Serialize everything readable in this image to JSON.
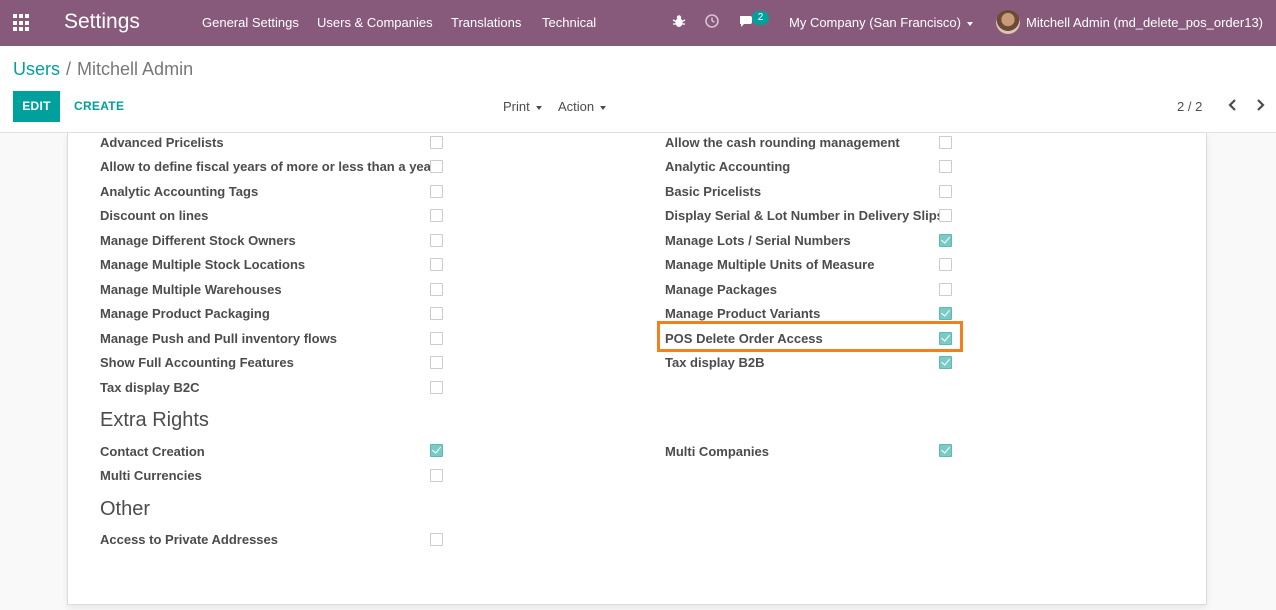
{
  "navbar": {
    "app_title": "Settings",
    "menu": [
      "General Settings",
      "Users & Companies",
      "Translations",
      "Technical"
    ],
    "message_count": "2",
    "company": "My Company (San Francisco)",
    "user": "Mitchell Admin (md_delete_pos_order13)",
    "color": "#875a7b"
  },
  "breadcrumb": {
    "parent": "Users",
    "separator": "/",
    "current": "Mitchell Admin"
  },
  "toolbar": {
    "edit": "EDIT",
    "create": "CREATE",
    "print": "Print",
    "action": "Action",
    "pager": "2 / 2"
  },
  "technical_settings": {
    "left": [
      {
        "label": "Advanced Pricelists",
        "checked": false
      },
      {
        "label": "Allow to define fiscal years of more or less than a year",
        "checked": false
      },
      {
        "label": "Analytic Accounting Tags",
        "checked": false
      },
      {
        "label": "Discount on lines",
        "checked": false
      },
      {
        "label": "Manage Different Stock Owners",
        "checked": false
      },
      {
        "label": "Manage Multiple Stock Locations",
        "checked": false
      },
      {
        "label": "Manage Multiple Warehouses",
        "checked": false
      },
      {
        "label": "Manage Product Packaging",
        "checked": false
      },
      {
        "label": "Manage Push and Pull inventory flows",
        "checked": false
      },
      {
        "label": "Show Full Accounting Features",
        "checked": false
      },
      {
        "label": "Tax display B2C",
        "checked": false
      }
    ],
    "right": [
      {
        "label": "Allow the cash rounding management",
        "checked": false
      },
      {
        "label": "Analytic Accounting",
        "checked": false
      },
      {
        "label": "Basic Pricelists",
        "checked": false
      },
      {
        "label": "Display Serial & Lot Number in Delivery Slips",
        "checked": false
      },
      {
        "label": "Manage Lots / Serial Numbers",
        "checked": true
      },
      {
        "label": "Manage Multiple Units of Measure",
        "checked": false
      },
      {
        "label": "Manage Packages",
        "checked": false
      },
      {
        "label": "Manage Product Variants",
        "checked": true
      },
      {
        "label": "POS Delete Order Access",
        "checked": true
      },
      {
        "label": "Tax display B2B",
        "checked": true
      }
    ]
  },
  "extra_rights": {
    "title": "Extra Rights",
    "left": [
      {
        "label": "Contact Creation",
        "checked": true
      },
      {
        "label": "Multi Currencies",
        "checked": false
      }
    ],
    "right": [
      {
        "label": "Multi Companies",
        "checked": true
      }
    ]
  },
  "other": {
    "title": "Other",
    "left": [
      {
        "label": "Access to Private Addresses",
        "checked": false
      }
    ]
  },
  "accent_color": "#00a09d",
  "highlight_color": "#f0811e"
}
